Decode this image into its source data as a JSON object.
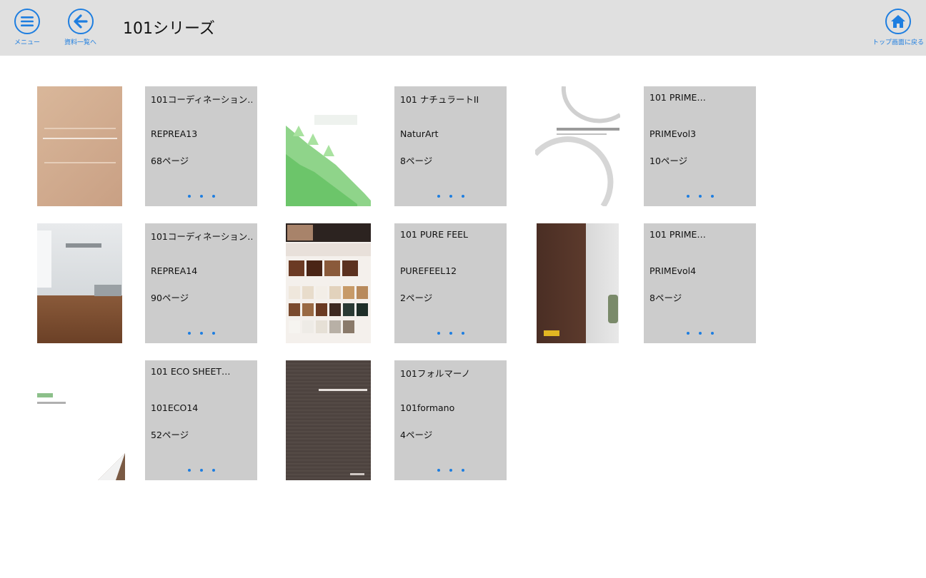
{
  "header": {
    "menu_label": "メニュー",
    "back_label": "資料一覧へ",
    "title": "101シリーズ",
    "home_label": "トップ画面に戻る",
    "accent": "#1e7ee0"
  },
  "cards": [
    {
      "title": "101コーディネーション…",
      "code": "REPREA13",
      "pages": "68ページ"
    },
    {
      "title": "101 ナチュラートII",
      "code": "NaturArt",
      "pages": "8ページ"
    },
    {
      "title": "101 PRIME…",
      "code": "PRIMEvol3",
      "pages": "10ページ"
    },
    {
      "title": "101コーディネーション…",
      "code": "REPREA14",
      "pages": "90ページ"
    },
    {
      "title": "101 PURE FEEL",
      "code": "PUREFEEL12",
      "pages": "2ページ"
    },
    {
      "title": "101 PRIME…",
      "code": "PRIMEvol4",
      "pages": "8ページ"
    },
    {
      "title": "101 ECO SHEET…",
      "code": "101ECO14",
      "pages": "52ページ"
    },
    {
      "title": "101フォルマーノ",
      "code": "101formano",
      "pages": "4ページ"
    }
  ]
}
